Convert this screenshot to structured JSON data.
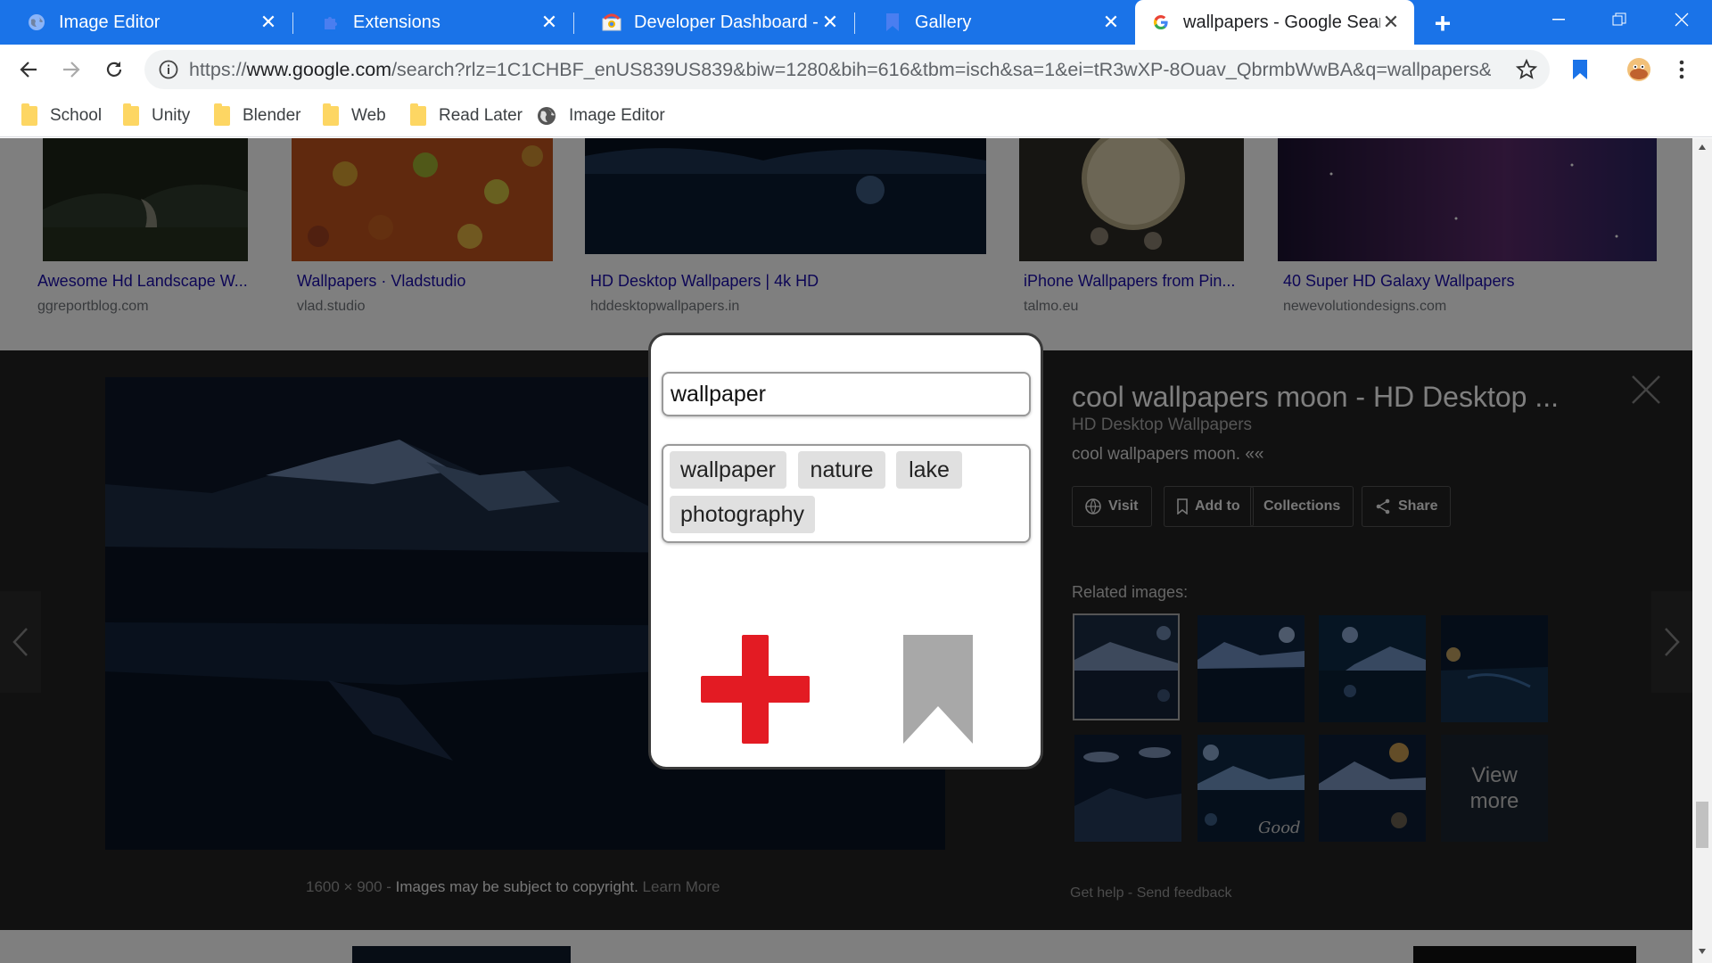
{
  "tabs": [
    {
      "title": "Image Editor",
      "icon": "globe-icon"
    },
    {
      "title": "Extensions",
      "icon": "puzzle-icon"
    },
    {
      "title": "Developer Dashboard - Chr",
      "icon": "chrome-webstore-icon"
    },
    {
      "title": "Gallery",
      "icon": "bookmark-icon"
    },
    {
      "title": "wallpapers - Google Search",
      "icon": "google-icon",
      "active": true
    }
  ],
  "address_bar": {
    "url_prefix": "https://",
    "url_host": "www.google.com",
    "url_rest": "/search?rlz=1C1CHBF_enUS839US839&biw=1280&bih=616&tbm=isch&sa=1&ei=tR3wXP-8Ouav_QbrmbWwBA&q=wallpapers&o..."
  },
  "bookmarks": [
    {
      "label": "School",
      "icon": "folder-icon"
    },
    {
      "label": "Unity",
      "icon": "folder-icon"
    },
    {
      "label": "Blender",
      "icon": "folder-icon"
    },
    {
      "label": "Web",
      "icon": "folder-icon"
    },
    {
      "label": "Read Later",
      "icon": "folder-icon"
    },
    {
      "label": "Image Editor",
      "icon": "globe-icon"
    }
  ],
  "results": [
    {
      "title": "Awesome Hd Landscape W...",
      "site": "ggreportblog.com"
    },
    {
      "title": "Wallpapers · Vladstudio",
      "site": "vlad.studio"
    },
    {
      "title": "HD Desktop Wallpapers | 4k HD",
      "site": "hddesktopwallpapers.in"
    },
    {
      "title": "iPhone Wallpapers from Pin...",
      "site": "talmo.eu"
    },
    {
      "title": "40 Super HD Galaxy Wallpapers",
      "site": "newevolutiondesigns.com"
    }
  ],
  "preview": {
    "title": "cool wallpapers moon - HD Desktop ...",
    "site": "HD Desktop Wallpapers",
    "desc": "cool wallpapers moon. ««",
    "actions": {
      "visit": "Visit",
      "add_to": "Add to",
      "collections": "Collections",
      "share": "Share"
    },
    "related_label": "Related images:",
    "view_more": "View more",
    "dimensions": "1600 × 900",
    "copyright": "Images may be subject to copyright.",
    "learn_more": "Learn More",
    "get_help": "Get help",
    "send_feedback": "Send feedback",
    "sep": " - "
  },
  "popup": {
    "input_value": "wallpaper",
    "tags": [
      "wallpaper",
      "nature",
      "lake",
      "photography"
    ],
    "add_color": "#e31b23",
    "bookmark_color": "#a8a8a8"
  },
  "colors": {
    "tabbar": "#1a73e8",
    "bookmark_star_active": "#1a73e8"
  }
}
